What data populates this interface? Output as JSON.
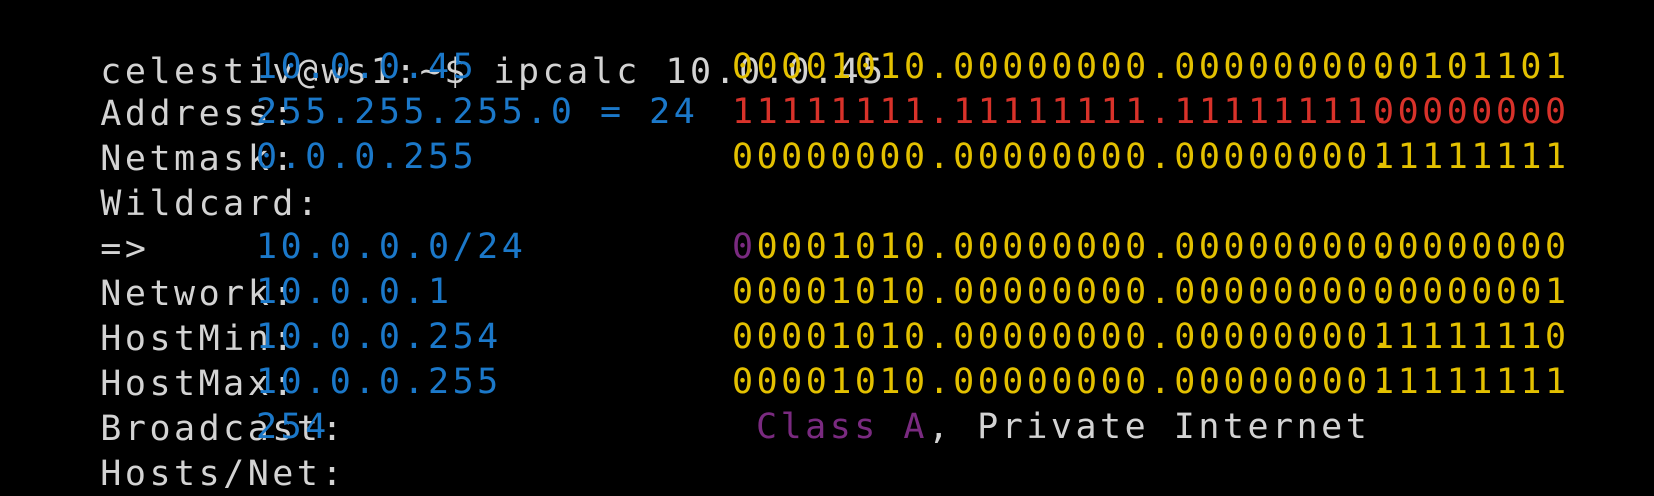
{
  "terminal": {
    "prompt": "celestiv@ws1:~$ ",
    "command": "ipcalc 10.0.0.45",
    "rows": {
      "address": {
        "label": "Address:",
        "value": "10.0.0.45",
        "bin_net": "00001010.00000000.00000000.",
        "bin_host": "00101101"
      },
      "netmask": {
        "label": "Netmask:",
        "value": "255.255.255.0 = 24",
        "bin_net": "11111111.11111111.11111111.",
        "bin_host": "00000000"
      },
      "wildcard": {
        "label": "Wildcard:",
        "value": "0.0.0.255",
        "bin_net": "00000000.00000000.00000000.",
        "bin_host": "11111111"
      },
      "arrow": "=>",
      "network": {
        "label": "Network:",
        "value": "10.0.0.0/24",
        "class_bit": "0",
        "bin_net": "0001010.00000000.00000000.",
        "bin_host": "00000000"
      },
      "hostmin": {
        "label": "HostMin:",
        "value": "10.0.0.1",
        "bin_net": "00001010.00000000.00000000.",
        "bin_host": "00000001"
      },
      "hostmax": {
        "label": "HostMax:",
        "value": "10.0.0.254",
        "bin_net": "00001010.00000000.00000000.",
        "bin_host": "11111110"
      },
      "broadcast": {
        "label": "Broadcast:",
        "value": "10.0.0.255",
        "bin_net": "00001010.00000000.00000000.",
        "bin_host": "11111111"
      },
      "hostsnet": {
        "label": "Hosts/Net:",
        "value": "254",
        "class_text": "Class A",
        "class_sep": ", ",
        "scope": "Private Internet"
      }
    }
  },
  "colors": {
    "background": "#000000",
    "label": "#d3d3d3",
    "value_blue": "#1b78c9",
    "binary_yellow": "#e3c000",
    "netmask_red": "#d8322a",
    "class_purple": "#7a2a80"
  }
}
